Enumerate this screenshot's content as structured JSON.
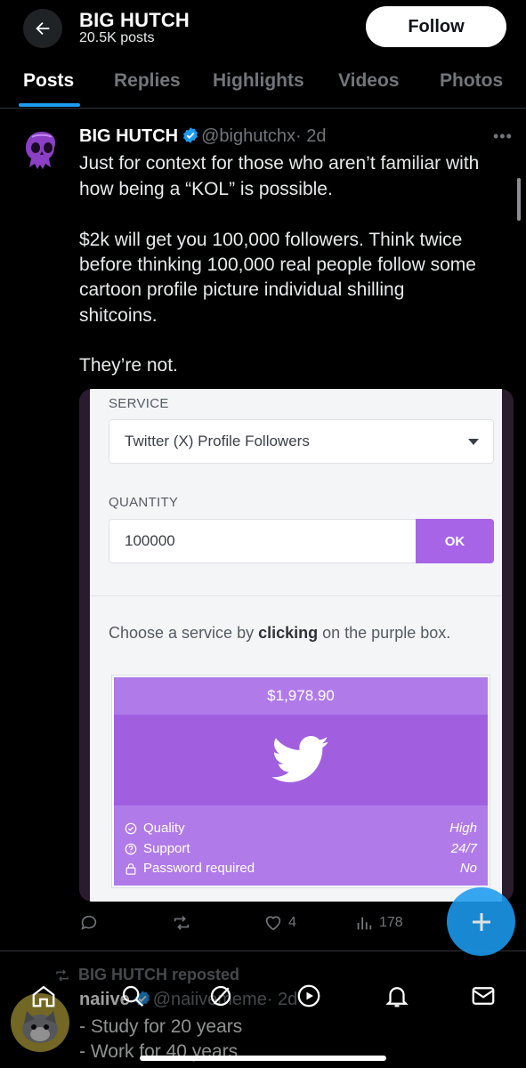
{
  "header": {
    "title": "BIG HUTCH",
    "subtitle": "20.5K posts",
    "follow_label": "Follow"
  },
  "tabs": [
    {
      "label": "Posts",
      "active": true
    },
    {
      "label": "Replies"
    },
    {
      "label": "Highlights"
    },
    {
      "label": "Videos"
    },
    {
      "label": "Photos"
    }
  ],
  "post": {
    "name": "BIG HUTCH",
    "handle": "@bighutchx",
    "time": "· 2d",
    "text_lines": [
      "Just for context for those who aren’t familiar with",
      "how being a “KOL” is possible.",
      "$2k will get you 100,000 followers. Think twice",
      "before thinking 100,000 real people follow some",
      "cartoon profile picture individual shilling",
      "shitcoins.",
      "They’re not."
    ],
    "media": {
      "service_label": "SERVICE",
      "service_value": "Twitter (X) Profile Followers",
      "quantity_label": "QUANTITY",
      "quantity_value": "100000",
      "ok_label": "OK",
      "choose_pre": "Choose a service by ",
      "choose_bold": "clicking",
      "choose_post": " on the purple box.",
      "price": "$1,978.90",
      "features": [
        {
          "label": "Quality",
          "value": "High"
        },
        {
          "label": "Support",
          "value": "24/7"
        },
        {
          "label": "Password required",
          "value": "No"
        }
      ]
    },
    "stats": {
      "likes": "4",
      "views": "178"
    }
  },
  "next_post": {
    "repost_text": "BIG HUTCH reposted",
    "name": "naiive",
    "handle": "@naiivememe",
    "time": "· 2d",
    "lines": [
      "- Study for 20 years",
      "- Work for 40 years"
    ]
  },
  "colors": {
    "accent": "#1d9bf0",
    "purple": "#a764e6",
    "muted": "#71767b"
  }
}
